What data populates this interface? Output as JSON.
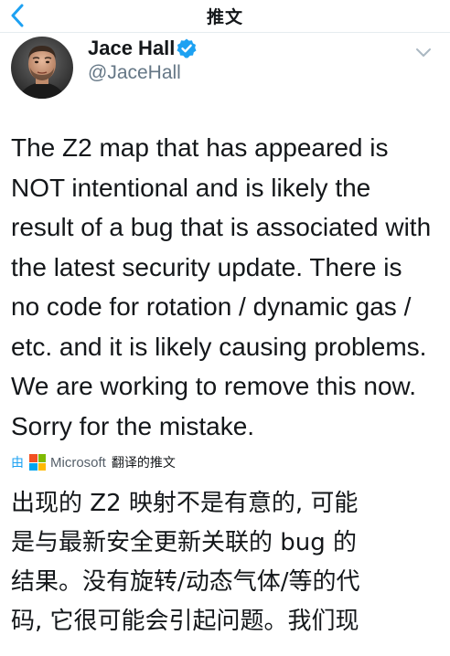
{
  "header": {
    "title": "推文",
    "back_icon": "chevron-left-icon"
  },
  "author": {
    "name": "Jace Hall",
    "handle": "@JaceHall",
    "verified": true,
    "verified_color": "#1da1f2"
  },
  "tweet": {
    "lines": [
      "The Z2 map that has appeared is",
      "NOT intentional and is likely the",
      "result of a bug that is associated with",
      "the latest security update. There is",
      "no code for rotation / dynamic gas /",
      "etc. and it is likely causing problems.",
      "We are working to remove this now.",
      "Sorry for the mistake."
    ]
  },
  "translation": {
    "by_label": "由",
    "provider": "Microsoft",
    "translated_label": "翻译的推文",
    "lines": [
      "出现的 Z2 映射不是有意的, 可能",
      "是与最新安全更新关联的 bug 的",
      "结果。没有旋转/动态气体/等的代",
      "码, 它很可能会引起问题。我们现"
    ]
  },
  "colors": {
    "accent": "#1da1f2",
    "text": "#14171a",
    "secondary": "#657786",
    "divider": "#e6ecf0",
    "ms_red": "#f25022",
    "ms_green": "#7fba00",
    "ms_blue": "#00a4ef",
    "ms_yellow": "#ffb900"
  }
}
